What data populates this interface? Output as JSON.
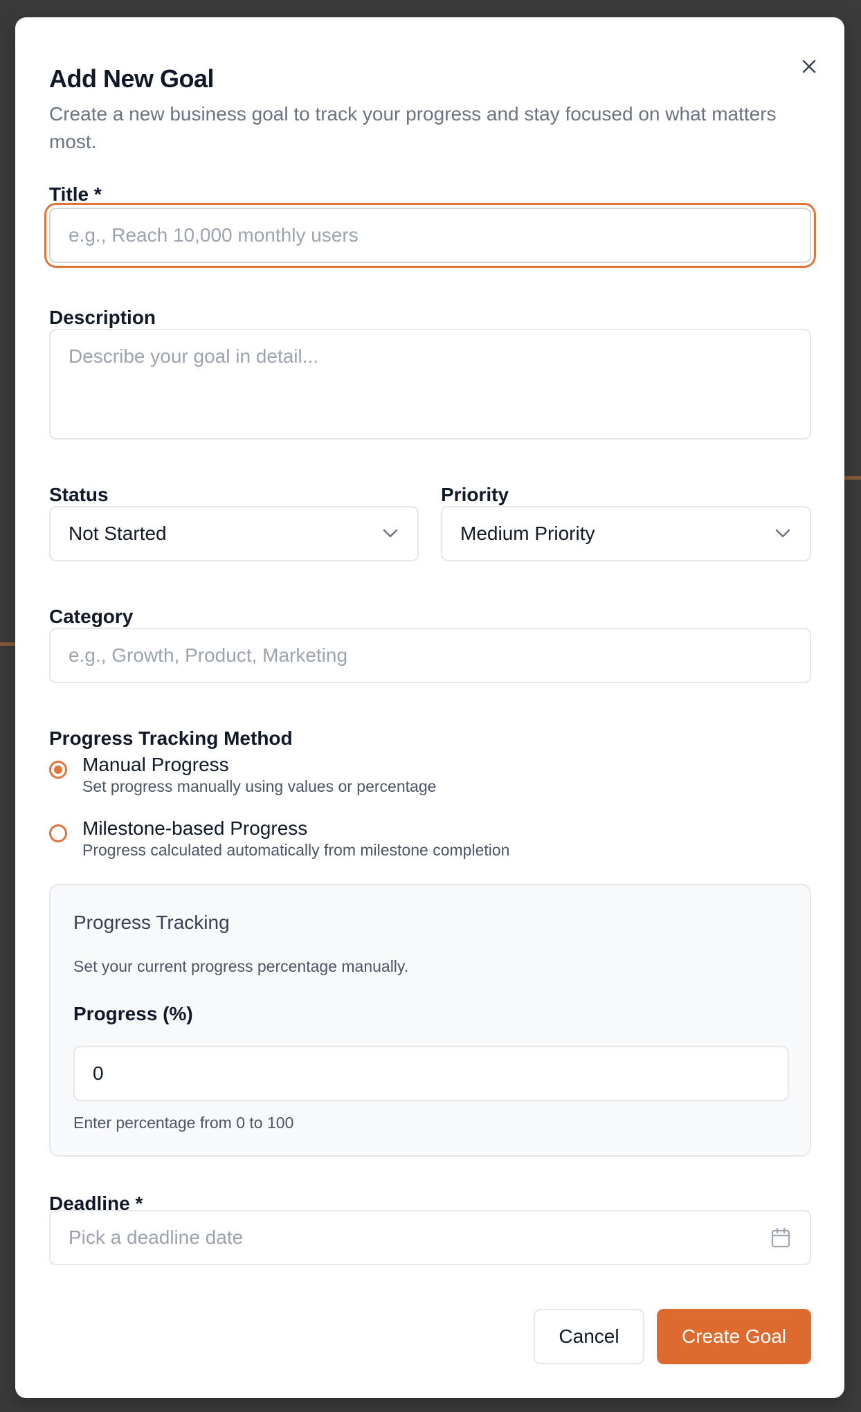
{
  "dialog": {
    "title": "Add New Goal",
    "subtitle": "Create a new business goal to track your progress and stay focused on what matters most."
  },
  "fields": {
    "title_label": "Title *",
    "title_placeholder": "e.g., Reach 10,000 monthly users",
    "description_label": "Description",
    "description_placeholder": "Describe your goal in detail...",
    "status_label": "Status",
    "status_value": "Not Started",
    "priority_label": "Priority",
    "priority_value": "Medium Priority",
    "category_label": "Category",
    "category_placeholder": "e.g., Growth, Product, Marketing",
    "deadline_label": "Deadline *",
    "deadline_placeholder": "Pick a deadline date"
  },
  "tracking": {
    "method_label": "Progress Tracking Method",
    "options": [
      {
        "title": "Manual Progress",
        "desc": "Set progress manually using values or percentage",
        "checked": true
      },
      {
        "title": "Milestone-based Progress",
        "desc": "Progress calculated automatically from milestone completion",
        "checked": false
      }
    ],
    "panel_title": "Progress Tracking",
    "panel_desc": "Set your current progress percentage manually.",
    "progress_label": "Progress (%)",
    "progress_value": "0",
    "progress_help": "Enter percentage from 0 to 100"
  },
  "buttons": {
    "cancel": "Cancel",
    "create": "Create Goal"
  },
  "colors": {
    "accent": "#dd6a2e",
    "focus_ring": "#e0743a"
  }
}
